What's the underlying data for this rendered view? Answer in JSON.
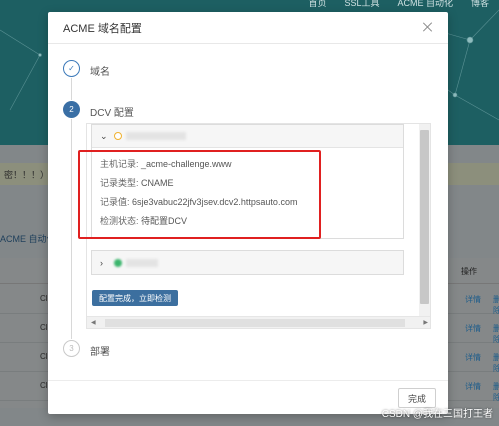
{
  "background": {
    "nav": [
      "首页",
      "SSL工具",
      "ACME 自动化",
      "博客"
    ],
    "warning_text": "密！！！）",
    "tab_text": "ACME 自动化",
    "table_header_op": "操作",
    "rows": [
      {
        "c1": "Cl",
        "detail": "详情",
        "delete": "删除"
      },
      {
        "c1": "Cl",
        "detail": "详情",
        "delete": "删除"
      },
      {
        "c1": "Cl",
        "detail": "详情",
        "delete": "删除"
      },
      {
        "c1": "Cl",
        "detail": "详情",
        "delete": "删除"
      }
    ]
  },
  "modal": {
    "title": "ACME 域名配置",
    "steps": [
      {
        "index": "✓",
        "label": "域名",
        "state": "done"
      },
      {
        "index": "2",
        "label": "DCV 配置",
        "state": "active"
      },
      {
        "index": "3",
        "label": "部署",
        "state": "wait"
      }
    ],
    "record": {
      "host_label": "主机记录: ",
      "host_value": "_acme-challenge.www",
      "type_label": "记录类型: ",
      "type_value": "CNAME",
      "value_label": "记录值: ",
      "value_value": "6sje3vabuc22jfv3jsev.dcv2.httpsauto.com",
      "status_label": "检测状态: ",
      "status_value": "待配置DCV"
    },
    "confirm_button": "配置完成，立即检测",
    "finish_button": "完成"
  },
  "watermark": "CSDN @我在三国打王者",
  "colors": {
    "primary": "#3a6fa5",
    "highlight": "#e02020",
    "hero": "#1d5f62"
  }
}
